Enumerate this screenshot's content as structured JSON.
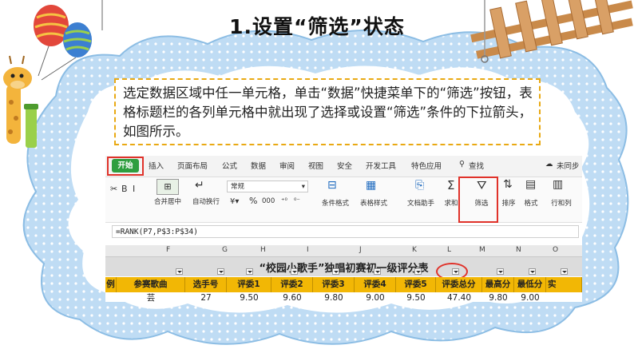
{
  "slide": {
    "title": "1.设置“筛选”状态",
    "instruction": "选定数据区域中任一单元格，单击“数据”快捷菜单下的“筛选”按钮，表格标题栏的各列单元格中就出现了选择或设置“筛选”条件的下拉箭头，如图所示。"
  },
  "ribbon": {
    "tabs": [
      "开始",
      "插入",
      "页面布局",
      "公式",
      "数据",
      "审阅",
      "视图",
      "安全",
      "开发工具",
      "特色应用",
      "查找",
      "未同步"
    ],
    "tools": {
      "merge": "合并居中",
      "wrap": "自动换行",
      "number_format": "常规",
      "percent": "%",
      "comma": "000",
      "cond_format": "条件格式",
      "table_style": "表格样式",
      "doc_helper": "文档助手",
      "sum": "求和",
      "filter": "筛选",
      "sort": "排序",
      "format": "格式",
      "row_col": "行和列"
    }
  },
  "formula_bar": "=RANK(P7,P$3:P$34)",
  "sheet": {
    "col_letters": [
      "F",
      "G",
      "H",
      "I",
      "J",
      "K",
      "L",
      "M",
      "N",
      "O"
    ],
    "title": "“校园小歌手”独唱初赛初一级评分表",
    "headers": [
      "例",
      "参赛歌曲",
      "选手号",
      "评委1",
      "评委2",
      "评委3",
      "评委4",
      "评委5",
      "评委总分",
      "最高分",
      "最低分",
      "实"
    ],
    "row1": [
      "",
      "芸",
      "27",
      "9.50",
      "9.60",
      "9.80",
      "9.00",
      "9.50",
      "47.40",
      "9.80",
      "9.00",
      ""
    ]
  },
  "colors": {
    "accent_red": "#e0322a",
    "instruction_border": "#e9a913",
    "cloud_border": "#a8cfee",
    "header_fill": "#f2b705",
    "start_button": "#2e9e3f"
  }
}
